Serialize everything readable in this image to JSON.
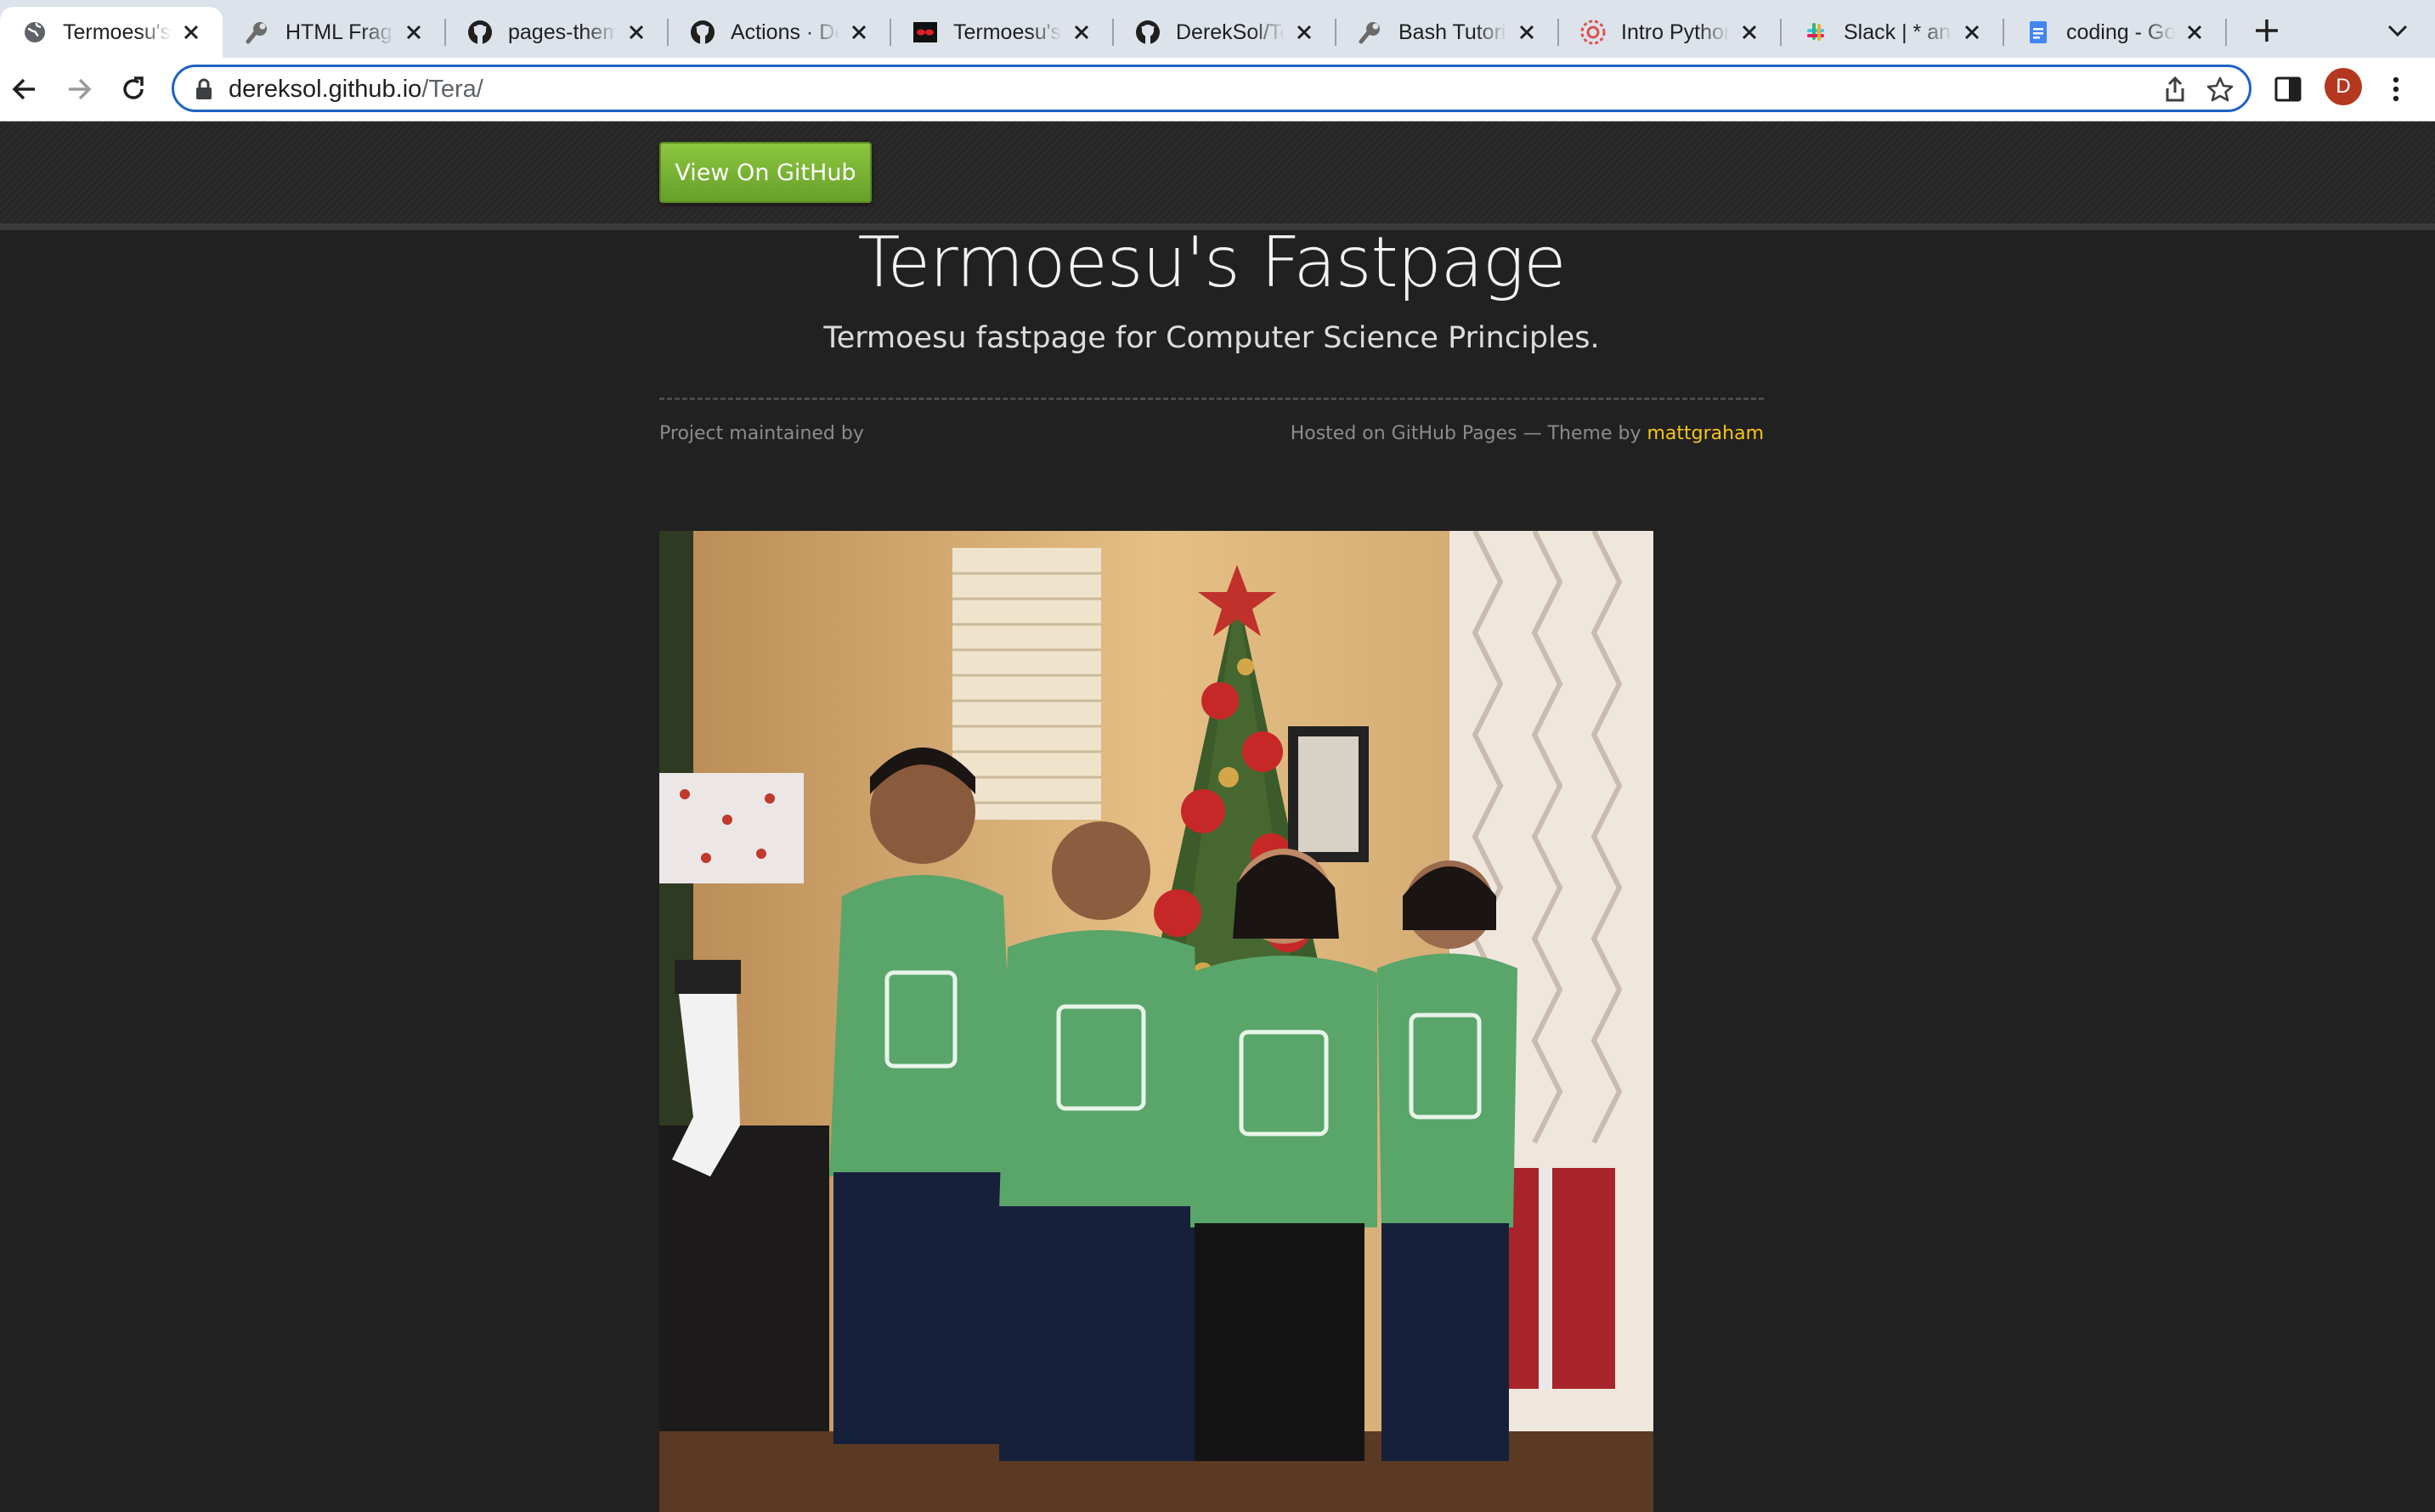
{
  "browser": {
    "tabs": [
      {
        "title": "Termoesu's Fastpage",
        "icon": "globe-icon",
        "active": true
      },
      {
        "title": "HTML Fragments",
        "icon": "wrench-icon",
        "active": false
      },
      {
        "title": "pages-themes",
        "icon": "github-icon",
        "active": false
      },
      {
        "title": "Actions · DerekSol",
        "icon": "github-icon",
        "active": false
      },
      {
        "title": "Termoesu's Fastpage",
        "icon": "mask-icon",
        "active": false
      },
      {
        "title": "DerekSol/Tera",
        "icon": "github-icon",
        "active": false
      },
      {
        "title": "Bash Tutorial",
        "icon": "wrench-icon",
        "active": false
      },
      {
        "title": "Intro Python",
        "icon": "flower-icon",
        "active": false
      },
      {
        "title": "Slack | * and",
        "icon": "slack-icon",
        "active": false
      },
      {
        "title": "coding - Google Docs",
        "icon": "docs-icon",
        "active": false
      }
    ],
    "address": {
      "host": "dereksol.github.io",
      "path": "/Tera/"
    },
    "profile_initial": "D"
  },
  "page": {
    "github_button": "View On GitHub",
    "title": "Termoesu's Fastpage",
    "subtitle": "Termoesu fastpage for Computer Science Principles.",
    "maintained_by": "Project maintained by",
    "hosted_prefix": "Hosted on GitHub Pages — Theme by",
    "theme_author": "mattgraham"
  },
  "colors": {
    "page_background": "#212121",
    "button_green": "#7cb342",
    "link_yellow": "#f5c518",
    "omnibox_focus": "#1f62c4",
    "avatar": "#b3381f"
  }
}
